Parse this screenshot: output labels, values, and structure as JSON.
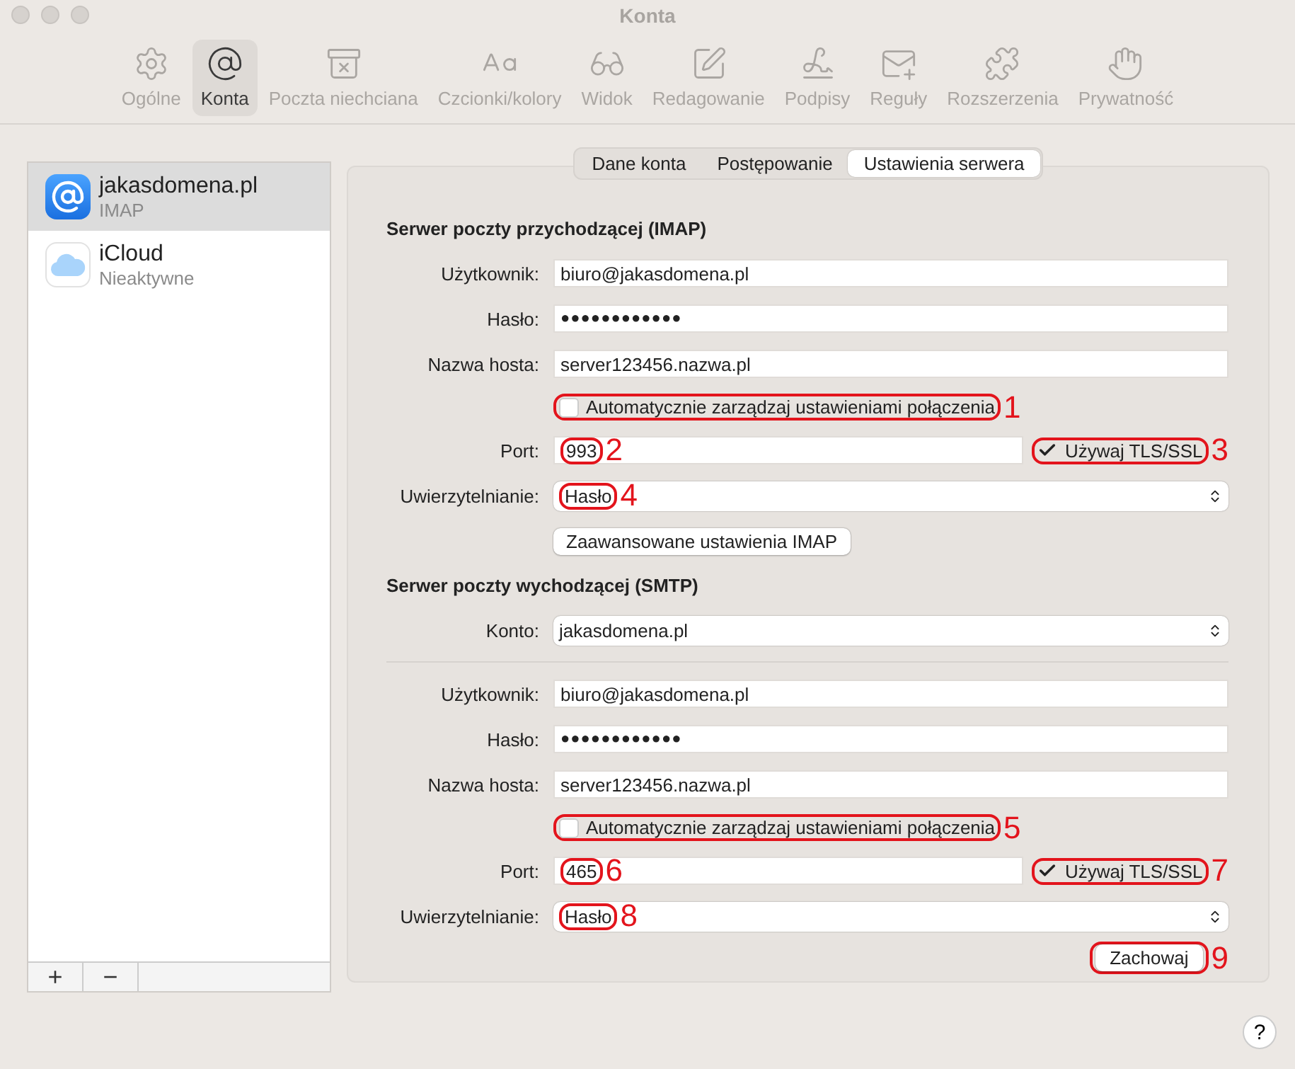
{
  "window": {
    "title": "Konta"
  },
  "toolbar": [
    {
      "label": "Ogólne",
      "selected": false
    },
    {
      "label": "Konta",
      "selected": true
    },
    {
      "label": "Poczta niechciana",
      "selected": false
    },
    {
      "label": "Czcionki/kolory",
      "selected": false
    },
    {
      "label": "Widok",
      "selected": false
    },
    {
      "label": "Redagowanie",
      "selected": false
    },
    {
      "label": "Podpisy",
      "selected": false
    },
    {
      "label": "Reguły",
      "selected": false
    },
    {
      "label": "Rozszerzenia",
      "selected": false
    },
    {
      "label": "Prywatność",
      "selected": false
    }
  ],
  "sidebar": {
    "accounts": [
      {
        "name": "jakasdomena.pl",
        "subtitle": "IMAP",
        "selected": true
      },
      {
        "name": "iCloud",
        "subtitle": "Nieaktywne",
        "selected": false
      }
    ],
    "buttons": [
      "+",
      "−"
    ]
  },
  "tabs": [
    {
      "label": "Dane konta",
      "selected": false
    },
    {
      "label": "Postępowanie",
      "selected": false
    },
    {
      "label": "Ustawienia serwera",
      "selected": true
    }
  ],
  "sections": [
    {
      "heading": "Serwer poczty przychodzącej (IMAP)",
      "rows": [
        {
          "kind": "text",
          "label": "Użytkownik:",
          "value": "biuro@jakasdomena.pl"
        },
        {
          "kind": "password",
          "label": "Hasło:",
          "value": "●●●●●●●●●●●●"
        },
        {
          "kind": "text",
          "label": "Nazwa hosta:",
          "value": "server123456.nazwa.pl"
        },
        {
          "kind": "checkbox",
          "text": "Automatycznie zarządzaj ustawieniami połączenia",
          "checked": false,
          "annotation": "1"
        },
        {
          "kind": "port",
          "label": "Port:",
          "value": "993",
          "annotation": "2",
          "tls": {
            "text": "Używaj TLS/SSL",
            "checked": true,
            "annotation": "3"
          }
        },
        {
          "kind": "select",
          "label": "Uwierzytelnianie:",
          "value": "Hasło",
          "annotation": "4"
        },
        {
          "kind": "button",
          "text": "Zaawansowane ustawienia IMAP"
        }
      ]
    },
    {
      "heading": "Serwer poczty wychodzącej (SMTP)",
      "rows": [
        {
          "kind": "select",
          "label": "Konto:",
          "value": "jakasdomena.pl"
        },
        {
          "kind": "divider"
        },
        {
          "kind": "text",
          "label": "Użytkownik:",
          "value": "biuro@jakasdomena.pl"
        },
        {
          "kind": "password",
          "label": "Hasło:",
          "value": "●●●●●●●●●●●●"
        },
        {
          "kind": "text",
          "label": "Nazwa hosta:",
          "value": "server123456.nazwa.pl"
        },
        {
          "kind": "checkbox",
          "text": "Automatycznie zarządzaj ustawieniami połączenia",
          "checked": false,
          "annotation": "5"
        },
        {
          "kind": "port",
          "label": "Port:",
          "value": "465",
          "annotation": "6",
          "tls": {
            "text": "Używaj TLS/SSL",
            "checked": true,
            "annotation": "7"
          }
        },
        {
          "kind": "select",
          "label": "Uwierzytelnianie:",
          "value": "Hasło",
          "annotation": "8"
        }
      ]
    }
  ],
  "save": {
    "text": "Zachowaj",
    "annotation": "9"
  },
  "help": "?"
}
